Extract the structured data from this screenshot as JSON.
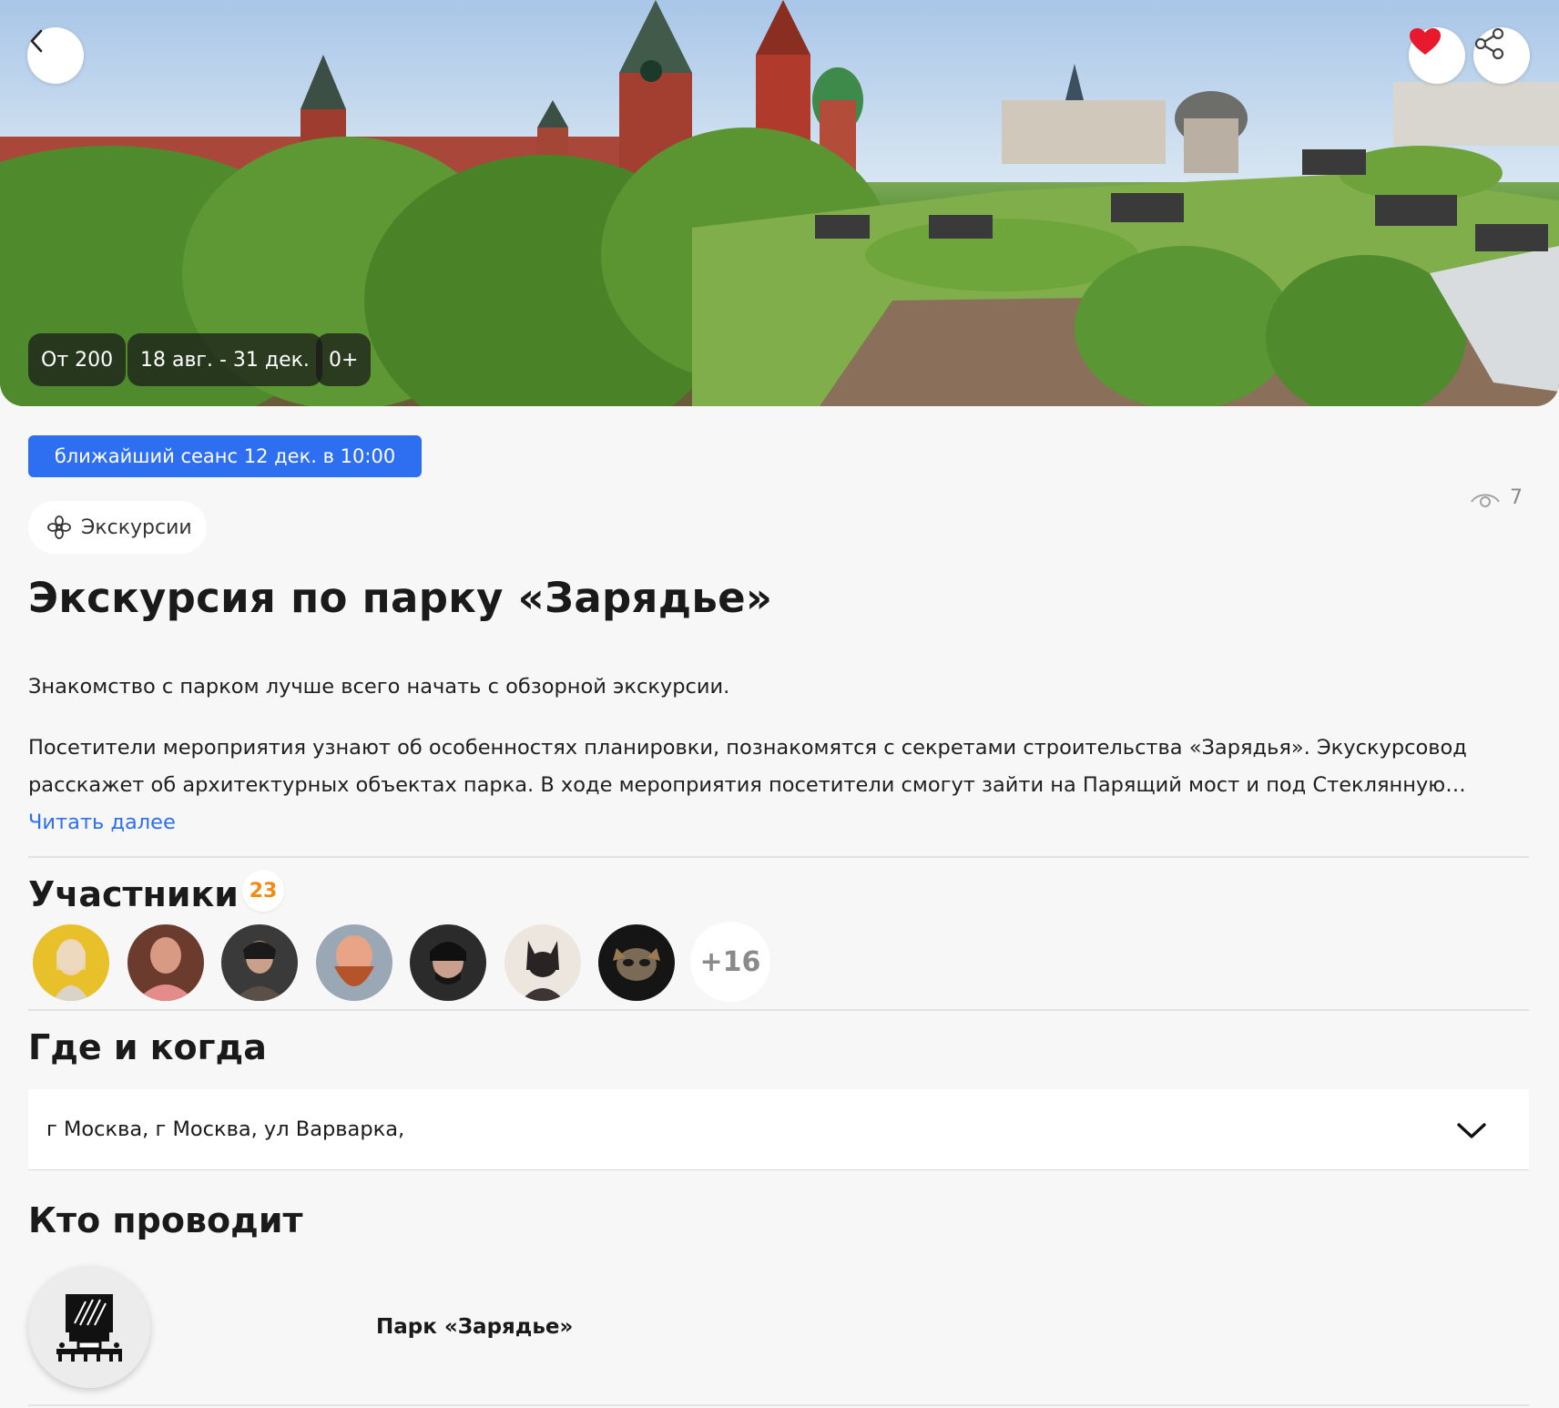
{
  "hero": {
    "price": "От 200",
    "dates": "18 авг. - 31 дек.",
    "age": "0+"
  },
  "session": "ближайший сеанс 12 дек. в 10:00",
  "views": "7",
  "category": "Экскурсии",
  "title": "Экскурсия по парку «Зарядье»",
  "description": {
    "lead": "Знакомство с парком лучше всего начать с обзорной экскурсии.",
    "line1": "Посетители мероприятия узнают об особенностях планировки, познакомятся с секретами строительства «Зарядья». Экускурсовод",
    "line2": "расскажет об архитектурных объектах парка. В ходе мероприятия посетители смогут зайти на Парящий мост и под Стеклянную…",
    "read_more": "Читать далее"
  },
  "participants": {
    "heading": "Участники",
    "count": "23",
    "more": "+16"
  },
  "where_when": {
    "heading": "Где и когда",
    "address": "г Москва, г Москва, ул Варварка,"
  },
  "organizer": {
    "heading": "Кто проводит",
    "name": "Парк «Зарядье»"
  },
  "colors": {
    "accent": "#2d6ff0",
    "badge_orange": "#f28b12",
    "heart": "#e8192c"
  },
  "icons": [
    "back-arrow-icon",
    "heart-icon",
    "share-icon",
    "eye-icon",
    "flower-icon",
    "chevron-down-icon"
  ]
}
